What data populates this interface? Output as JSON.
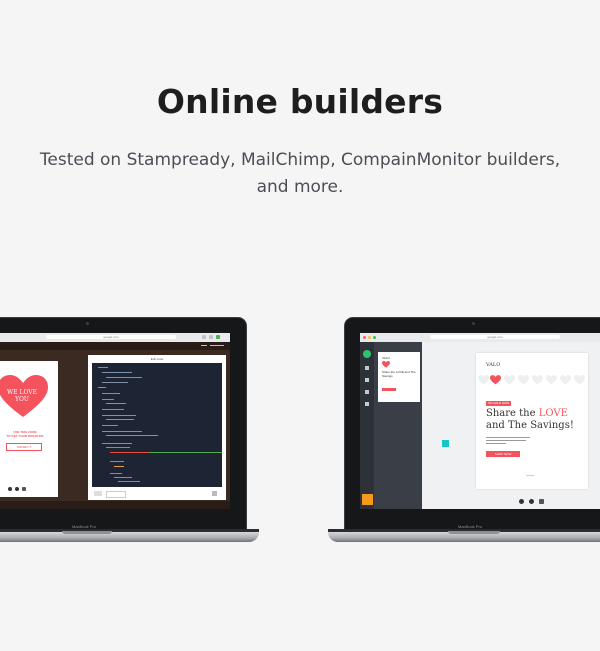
{
  "header": {
    "title": "Online builders",
    "subtitle": "Tested on Stampready, MailChimp, CompainMonitor builders, and more."
  },
  "laptop_left": {
    "brand": "MacBook Pro",
    "url": "google.com",
    "panel_title": "Edit code",
    "card": {
      "heart_text": "WE LOVE YOU",
      "line1": "USE THIS CODE",
      "line2": "TO GET YOUR DISCOUNT",
      "button": "ORDER IT"
    }
  },
  "laptop_right": {
    "brand": "MacBook Pro",
    "url": "google.com",
    "email": {
      "logo": "VALO",
      "badge": "ON SALE NOW",
      "heading_part1": "Share the ",
      "heading_love": "LOVE",
      "heading_part2": "and The Savings!",
      "button": "SHOP NOW"
    },
    "thumb": {
      "logo": "VALO",
      "heading": "Share the LOVE and The Savings"
    }
  },
  "colors": {
    "accent_red": "#f4535d",
    "builder_green": "#2cc36b",
    "builder_orange": "#f59a1b",
    "builder_teal": "#19c4c4"
  }
}
